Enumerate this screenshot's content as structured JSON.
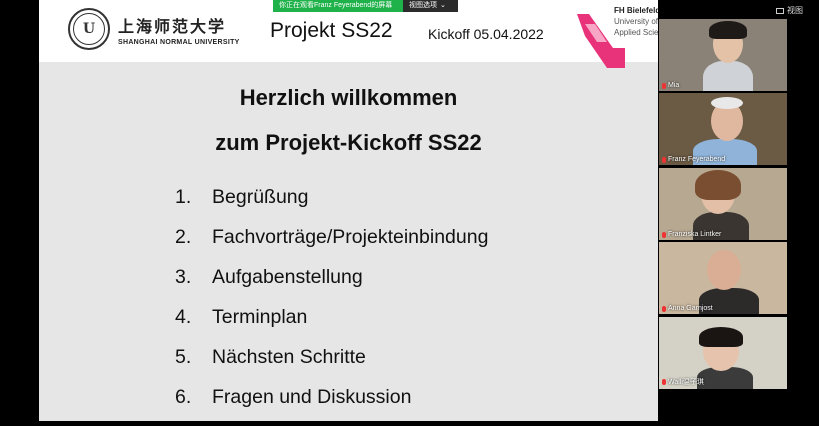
{
  "share_banner": {
    "sharing_text": "你正在观看Franz Feyerabend的屏幕",
    "view_options": "视图选项"
  },
  "view_button": {
    "label": "视图"
  },
  "slide": {
    "header": {
      "university_cn": "上海师范大学",
      "university_en": "SHANGHAI NORMAL UNIVERSITY",
      "project_title": "Projekt SS22",
      "kickoff": "Kickoff 05.04.2022",
      "fh_name": "FH Bielefeld",
      "fh_line2": "University of",
      "fh_line3": "Applied Sciences"
    },
    "welcome_line1": "Herzlich willkommen",
    "welcome_line2": "zum Projekt-Kickoff SS22",
    "agenda": [
      {
        "num": "1.",
        "text": "Begrüßung"
      },
      {
        "num": "2.",
        "text": "Fachvorträge/Projekteinbindung"
      },
      {
        "num": "3.",
        "text": "Aufgabenstellung"
      },
      {
        "num": "4.",
        "text": "Terminplan"
      },
      {
        "num": "5.",
        "text": "Nächsten Schritte"
      },
      {
        "num": "6.",
        "text": "Fragen und Diskussion"
      }
    ]
  },
  "participants": [
    {
      "name": "Mia",
      "bg": "#8a8276",
      "muted": true
    },
    {
      "name": "Franz Feyerabend",
      "bg": "#6b5a44",
      "muted": true
    },
    {
      "name": "Franziska Lintker",
      "bg": "#b7a892",
      "muted": true
    },
    {
      "name": "Anna Garnjost",
      "bg": "#c9b79f",
      "muted": true
    },
    {
      "name": "Walli温子琪",
      "bg": "#d4d2c6",
      "muted": true
    }
  ]
}
